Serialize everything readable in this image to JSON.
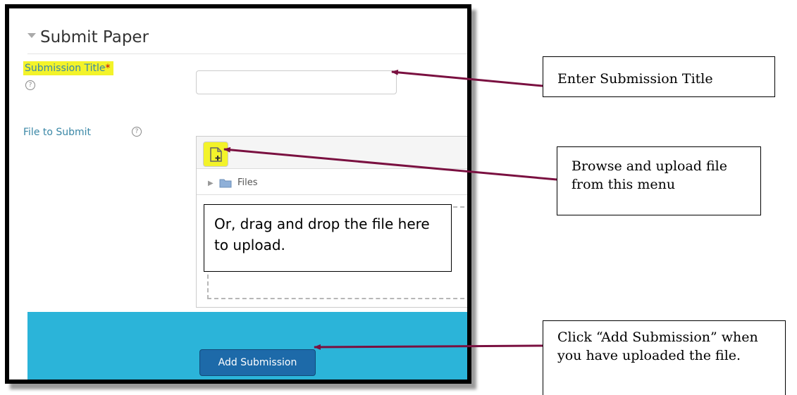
{
  "form": {
    "section_title": "Submit Paper",
    "submission_title_label": "Submission Title",
    "required_marker": "*",
    "file_label": "File to Submit",
    "help_glyph": "?",
    "files_folder_label": "Files",
    "submit_button_label": "Add Submission"
  },
  "callouts": {
    "title": "Enter Submission Title",
    "browse": "Browse and upload file from this menu",
    "drag": "Or, drag and drop the file here to upload.",
    "submit": "Click “Add Submission” when you have uploaded the file."
  },
  "colors": {
    "highlight": "#f3f32a",
    "arrow": "#7a1040",
    "footer_bar": "#2bb4d9",
    "button": "#1d6aa9",
    "label_text": "#3a87a6"
  }
}
